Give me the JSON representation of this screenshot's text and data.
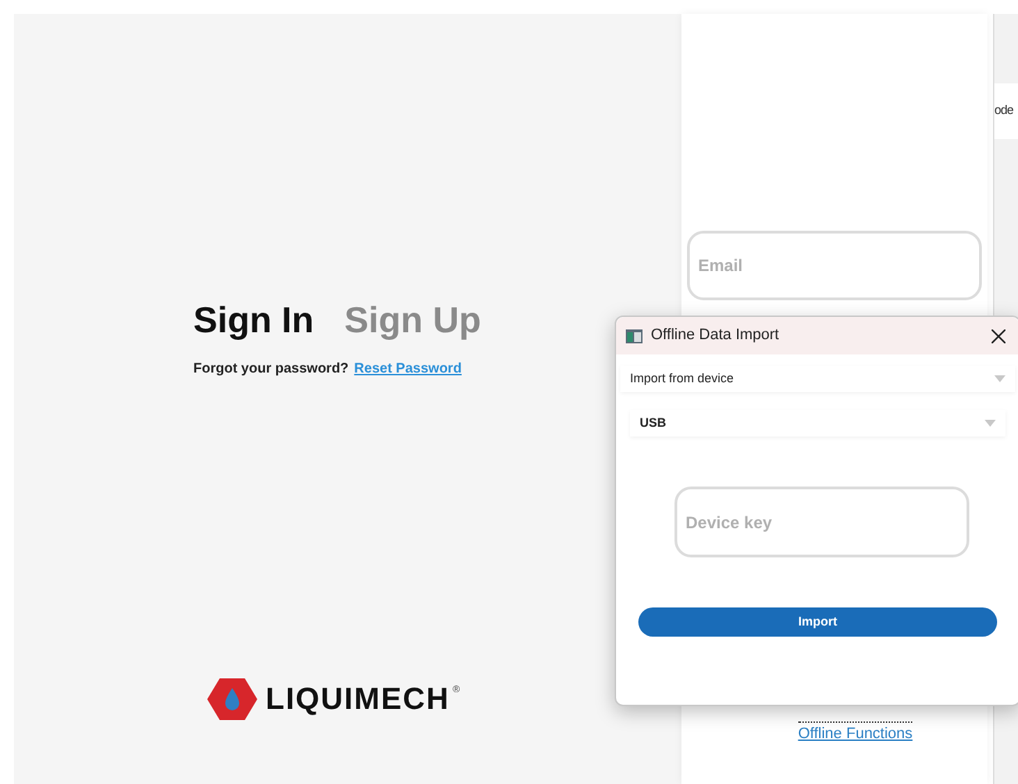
{
  "auth": {
    "tabs": [
      {
        "label": "Sign In",
        "selected": true
      },
      {
        "label": "Sign Up",
        "selected": false
      }
    ],
    "forgot_text": "Forgot your password?",
    "reset_link": "Reset Password"
  },
  "logo": {
    "name": "LIQUIMECH",
    "mark": "®"
  },
  "login_card": {
    "email": {
      "placeholder": "Email"
    },
    "offline_link": "Offline Functions"
  },
  "side_panel": {
    "text": "ode"
  },
  "dialog": {
    "title": "Offline Data Import",
    "source": {
      "value": "Import from device"
    },
    "connection": {
      "value": "USB"
    },
    "device_key": {
      "placeholder": "Device key"
    },
    "button": "Import"
  }
}
